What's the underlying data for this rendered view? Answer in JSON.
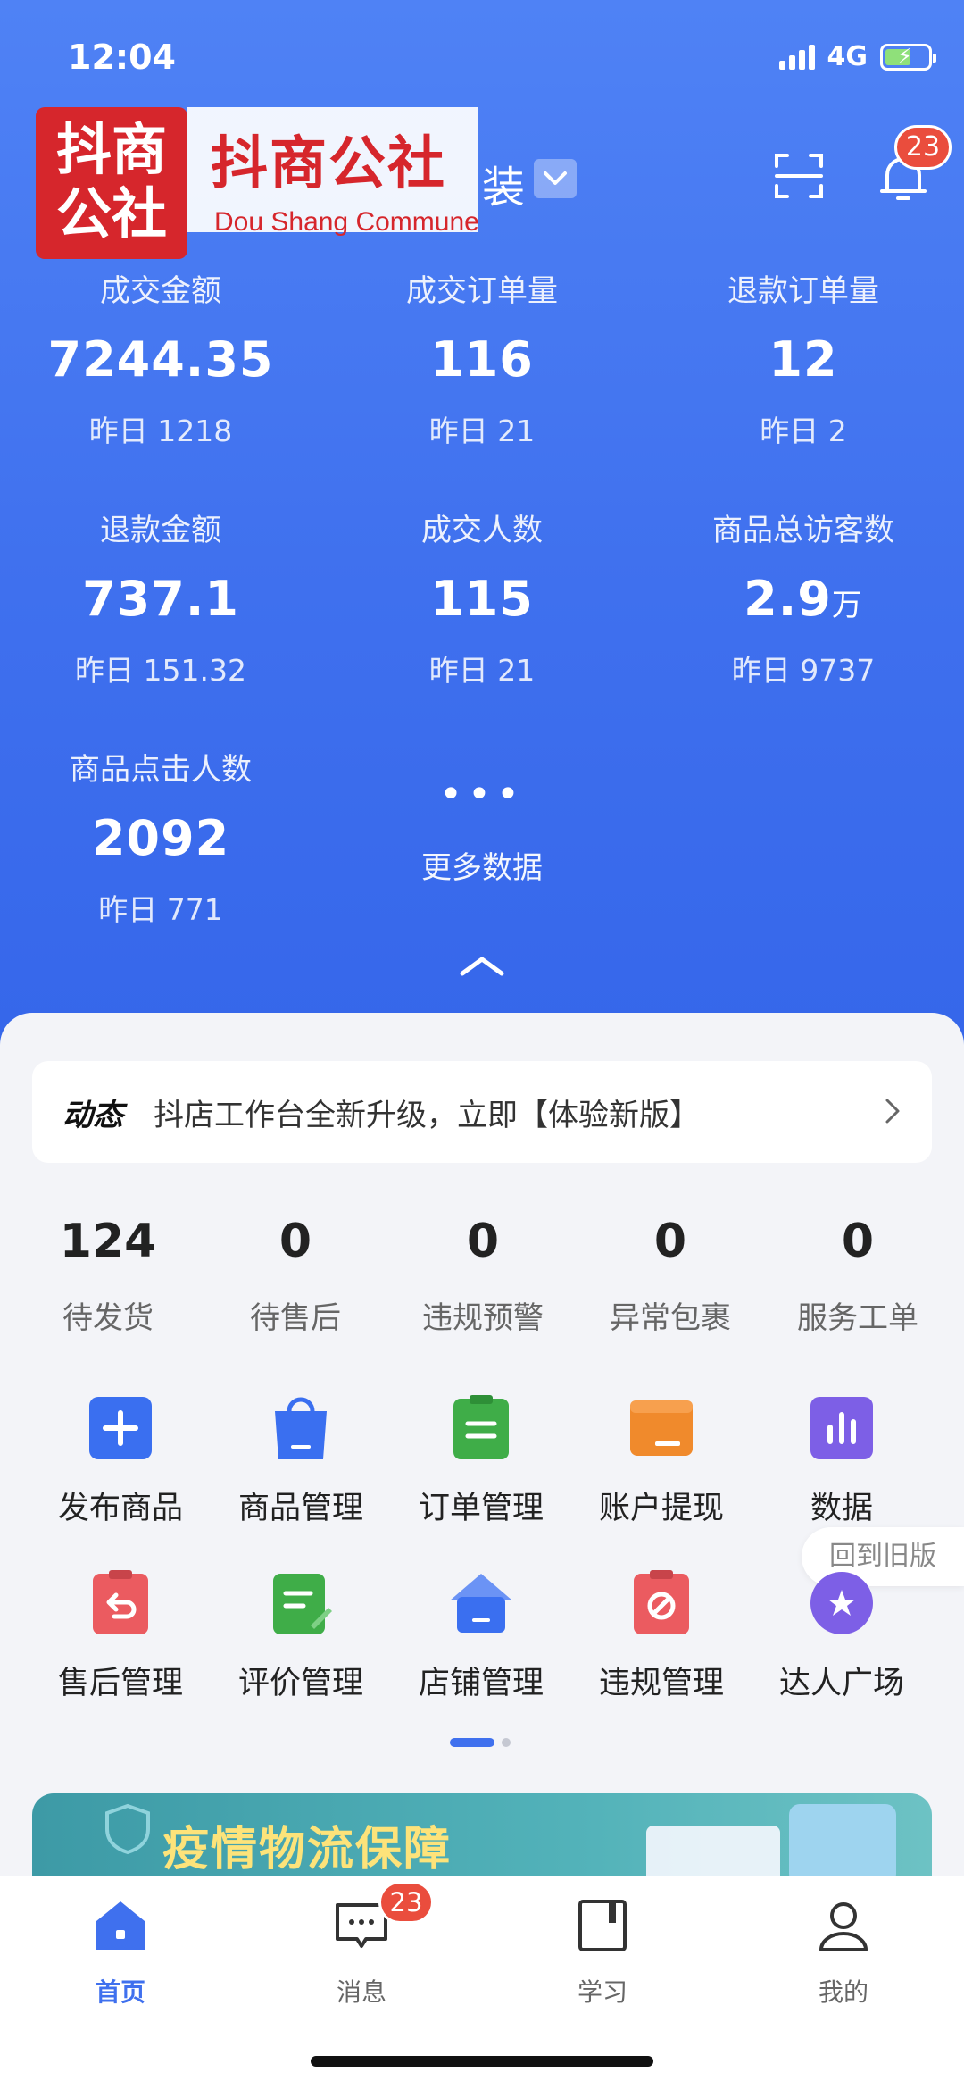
{
  "status": {
    "time": "12:04",
    "network": "4G"
  },
  "watermark": {
    "logo_text": "抖商公社",
    "name": "抖商公社",
    "english": "Dou Shang Commune"
  },
  "header": {
    "shop_name_visible": "装",
    "notification_count": "23"
  },
  "metrics": [
    {
      "label": "成交金额",
      "value": "7244.35",
      "unit": "",
      "yesterday": "昨日 1218"
    },
    {
      "label": "成交订单量",
      "value": "116",
      "unit": "",
      "yesterday": "昨日 21"
    },
    {
      "label": "退款订单量",
      "value": "12",
      "unit": "",
      "yesterday": "昨日 2"
    },
    {
      "label": "退款金额",
      "value": "737.1",
      "unit": "",
      "yesterday": "昨日 151.32"
    },
    {
      "label": "成交人数",
      "value": "115",
      "unit": "",
      "yesterday": "昨日 21"
    },
    {
      "label": "商品总访客数",
      "value": "2.9",
      "unit": "万",
      "yesterday": "昨日 9737"
    },
    {
      "label": "商品点击人数",
      "value": "2092",
      "unit": "",
      "yesterday": "昨日 771"
    }
  ],
  "more_data": {
    "dots": "•••",
    "label": "更多数据"
  },
  "news": {
    "tag": "动态",
    "text": "抖店工作台全新升级，立即【体验新版】"
  },
  "todos": [
    {
      "count": "124",
      "label": "待发货"
    },
    {
      "count": "0",
      "label": "待售后"
    },
    {
      "count": "0",
      "label": "违规预警"
    },
    {
      "count": "0",
      "label": "异常包裹"
    },
    {
      "count": "0",
      "label": "服务工单"
    }
  ],
  "tools": [
    {
      "label": "发布商品",
      "icon": "plus-icon",
      "color": "#3a6ff0"
    },
    {
      "label": "商品管理",
      "icon": "shopping-bag-icon",
      "color": "#3a6ff0"
    },
    {
      "label": "订单管理",
      "icon": "clipboard-icon",
      "color": "#3fad48"
    },
    {
      "label": "账户提现",
      "icon": "wallet-icon",
      "color": "#f08a2c"
    },
    {
      "label": "数据",
      "icon": "bar-chart-icon",
      "color": "#7d5fe6"
    },
    {
      "label": "售后管理",
      "icon": "return-icon",
      "color": "#eb5b60"
    },
    {
      "label": "评价管理",
      "icon": "review-icon",
      "color": "#3fad48"
    },
    {
      "label": "店铺管理",
      "icon": "store-icon",
      "color": "#3a6ff0"
    },
    {
      "label": "违规管理",
      "icon": "violation-icon",
      "color": "#eb5b60"
    },
    {
      "label": "达人广场",
      "icon": "star-icon",
      "color": "#7d5fe6"
    }
  ],
  "old_version": "回到旧版",
  "banner": {
    "title": "疫情物流保障"
  },
  "tabbar": {
    "items": [
      {
        "label": "首页",
        "icon": "home-icon"
      },
      {
        "label": "消息",
        "icon": "message-icon"
      },
      {
        "label": "学习",
        "icon": "book-icon"
      },
      {
        "label": "我的",
        "icon": "user-icon"
      }
    ],
    "message_badge": "23"
  }
}
